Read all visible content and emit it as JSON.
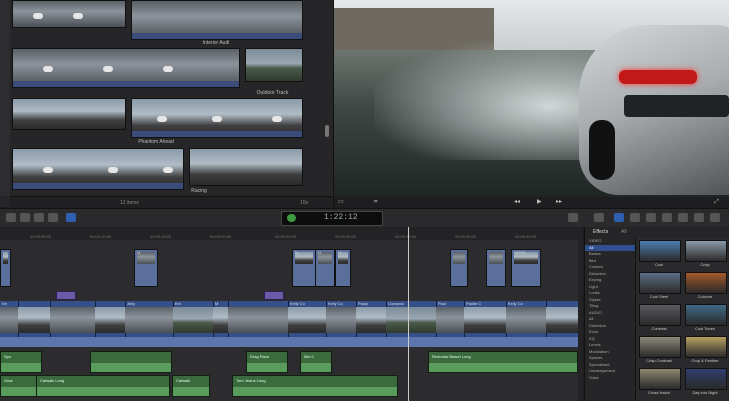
{
  "browser": {
    "clip_labels": [
      "Interior Audi",
      "Outdoor Track",
      "Phantom Ahead",
      "Racing"
    ],
    "footer_count": "12 items",
    "footer_zoom": "10s"
  },
  "toolbar": {
    "timecode": "1:22:12"
  },
  "timeline": {
    "ruler_ticks": [
      "00:00:05:00",
      "00:00:10:00",
      "00:00:15:00",
      "00:00:20:00",
      "00:00:25:00",
      "00:00:30:00",
      "00:00:35:00",
      "00:00:40:00",
      "00:00:45:00",
      "00:00:50:00"
    ],
    "connected_labels": [
      "M",
      "M",
      "M",
      "M",
      "GOPR"
    ],
    "storyline_labels": [
      "Ke",
      "Jelly",
      "Kel",
      "M",
      "Kelly Co",
      "Kelly Co",
      "Pauly",
      "Composi",
      "Paul",
      "Paulie C",
      "Kelly Co"
    ],
    "audio_clips": [
      "Gear",
      "Catwalk Long",
      "Catwalk",
      "Torn Jeans Long",
      "Drag Race",
      "Mid C",
      "Redondo Beach Long",
      "Spo"
    ]
  },
  "effects": {
    "title": "Effects",
    "header_all": "All",
    "categories": [
      "VIDEO",
      "All",
      "Basics",
      "Blur",
      "Custom",
      "Distortion",
      "Keying",
      "Light",
      "Looks",
      "Stylize",
      "Tiling",
      "AUDIO",
      "All",
      "Distortion",
      "Echo",
      "EQ",
      "Levels",
      "Modulation",
      "Spaces",
      "Specialized",
      "Uncategorized",
      "Voice"
    ],
    "items": [
      {
        "label": "Cool",
        "color": "#4f7fb0"
      },
      {
        "label": "Crisp",
        "color": "#8a9aa8"
      },
      {
        "label": "Cool Steel",
        "color": "#5d6f86"
      },
      {
        "label": "Colorize",
        "color": "#a45a2c"
      },
      {
        "label": "Contrast",
        "color": "#5a5a60"
      },
      {
        "label": "Cool Tones",
        "color": "#3f6a88"
      },
      {
        "label": "Crisp Contrast",
        "color": "#8d8a7c"
      },
      {
        "label": "Crop & Feather",
        "color": "#b7a061"
      },
      {
        "label": "Cross Hatch",
        "color": "#8e8670"
      },
      {
        "label": "Day into Night",
        "color": "#2f3f6f"
      }
    ]
  }
}
